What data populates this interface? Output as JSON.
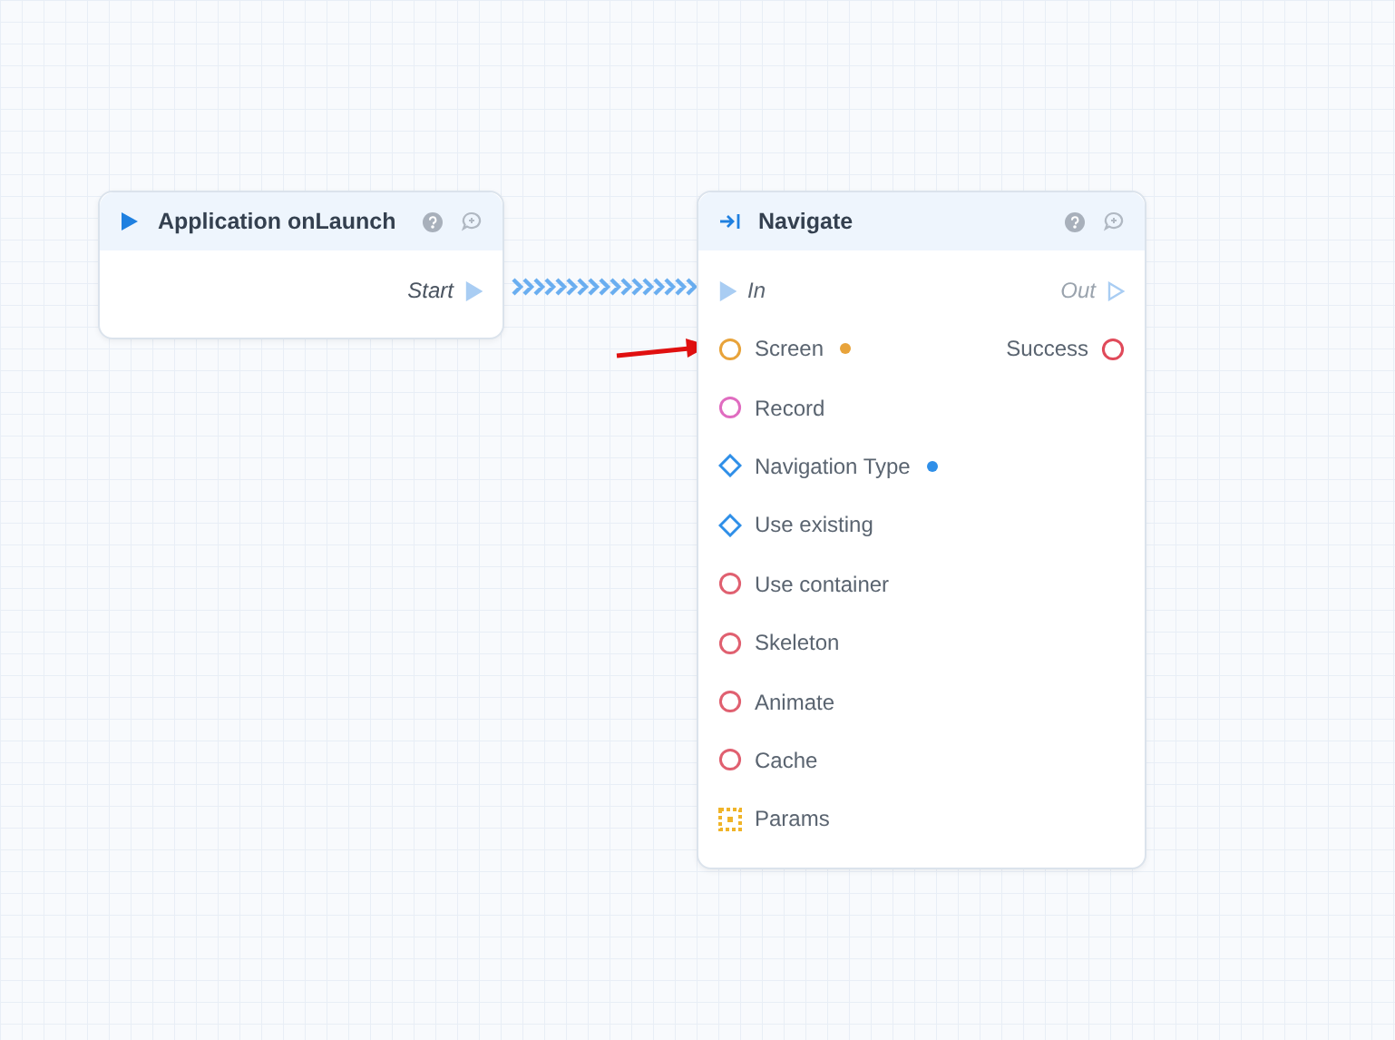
{
  "nodes": [
    {
      "title": "Application onLaunch",
      "kind": "event",
      "flow_out": "Start"
    },
    {
      "title": "Navigate",
      "kind": "action",
      "flow_in": "In",
      "flow_out": "Out",
      "inputs": [
        {
          "label": "Screen",
          "kind": "circle",
          "color": "#e8a33a",
          "connected": true
        },
        {
          "label": "Record",
          "kind": "circle",
          "color": "#e06cc0",
          "connected": false
        },
        {
          "label": "Navigation Type",
          "kind": "diamond",
          "color": "#2f8fe8",
          "connected": true
        },
        {
          "label": "Use existing",
          "kind": "diamond",
          "color": "#2f8fe8",
          "connected": false
        },
        {
          "label": "Use container",
          "kind": "circle",
          "color": "#e06070",
          "connected": false
        },
        {
          "label": "Skeleton",
          "kind": "circle",
          "color": "#e06070",
          "connected": false
        },
        {
          "label": "Animate",
          "kind": "circle",
          "color": "#e06070",
          "connected": false
        },
        {
          "label": "Cache",
          "kind": "circle",
          "color": "#e06070",
          "connected": false
        },
        {
          "label": "Params",
          "kind": "grid",
          "color": "#f0b429",
          "connected": false
        }
      ],
      "outputs": [
        {
          "label": "Success",
          "kind": "circle",
          "color": "#e04a5a"
        }
      ]
    }
  ]
}
